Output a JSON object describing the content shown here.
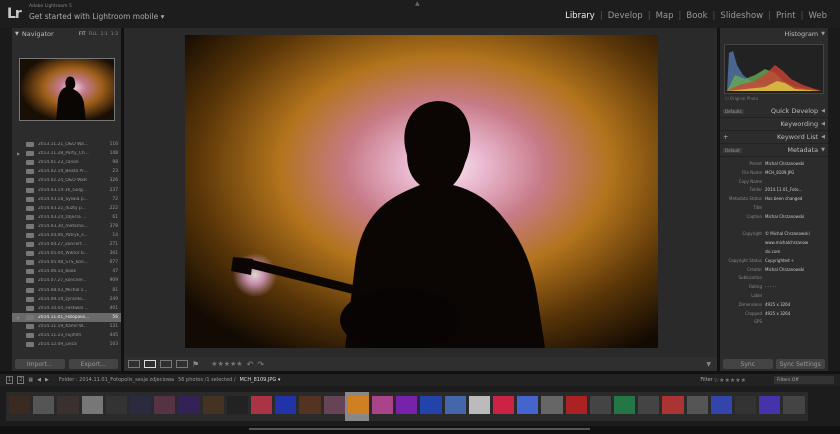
{
  "app": {
    "logo": "Lr",
    "name": "Adobe Lightroom 5",
    "identity_plate": "Get started with Lightroom mobile ▾"
  },
  "modules": [
    "Library",
    "Develop",
    "Map",
    "Book",
    "Slideshow",
    "Print",
    "Web"
  ],
  "active_module": "Library",
  "navigator": {
    "title": "Navigator",
    "zoom_options": [
      "FIT",
      "FILL",
      "1:1",
      "1:3"
    ]
  },
  "folders": [
    {
      "name": "2013.11.21_O&O Wa...",
      "count": "116"
    },
    {
      "name": "2013.11.28_Party_Ch...",
      "count": "148"
    },
    {
      "name": "2014.01.23_canon",
      "count": "98"
    },
    {
      "name": "2014.02.19_Beata Pr...",
      "count": "23"
    },
    {
      "name": "2014.02.24_O&O WaR",
      "count": "326"
    },
    {
      "name": "2014.03.14-16_Golg...",
      "count": "237"
    },
    {
      "name": "2014.03.18_Sylwia p...",
      "count": "72"
    },
    {
      "name": "2014.03.22_duzty p...",
      "count": "222"
    },
    {
      "name": "2014.03.24_zdjecia ...",
      "count": "61"
    },
    {
      "name": "2014.03.30_metamo...",
      "count": "378"
    },
    {
      "name": "2014.04.06_Patryk_s...",
      "count": "14"
    },
    {
      "name": "2014.04.27_koncert ...",
      "count": "271"
    },
    {
      "name": "2014.05.04_Wiktor b...",
      "count": "361"
    },
    {
      "name": "2014.05.08_STS_kon...",
      "count": "677"
    },
    {
      "name": "2014.06.14_book",
      "count": "47"
    },
    {
      "name": "2014.07.27_koncner...",
      "count": "909"
    },
    {
      "name": "2014.08.03_Michal s...",
      "count": "81"
    },
    {
      "name": "2014.09.19_zyrardo...",
      "count": "249"
    },
    {
      "name": "2014.10.04_Festiwal ...",
      "count": "401"
    },
    {
      "name": "2014.11.01_Fotopolis...",
      "count": "56",
      "selected": true
    },
    {
      "name": "2014.11.19_Kamil W...",
      "count": "131"
    },
    {
      "name": "2014.11.23_Fujifilm",
      "count": "445"
    },
    {
      "name": "2014.12.09_Leica",
      "count": "103"
    }
  ],
  "left_buttons": {
    "import": "Import...",
    "export": "Export..."
  },
  "right_panel": {
    "histogram": "Histogram",
    "original_photo": "Original Photo",
    "quick_develop": "Quick Develop",
    "quick_develop_preset": "Defaults",
    "keywording": "Keywording",
    "keyword_list": "Keyword List",
    "metadata": "Metadata",
    "metadata_preset": "Default"
  },
  "metadata": [
    {
      "key": "Preset",
      "value": "Michal Chrzanowski"
    },
    {
      "key": "File Name",
      "value": "MCH_8109.JPG"
    },
    {
      "key": "Copy Name",
      "value": ""
    },
    {
      "key": "Folder",
      "value": "2014.11.01_Foto..."
    },
    {
      "key": "Metadata Status",
      "value": "Has been changed"
    },
    {
      "key": "Title",
      "value": ""
    },
    {
      "key": "Caption",
      "value": "Michal Chrzanowski"
    },
    {
      "key": "",
      "value": ""
    },
    {
      "key": "Copyright",
      "value": "© Michal Chrzanowski"
    },
    {
      "key": "",
      "value": "www.michalchrzanow"
    },
    {
      "key": "",
      "value": "ski.com"
    },
    {
      "key": "Copyright Status",
      "value": "Copyrighted ÷"
    },
    {
      "key": "Creator",
      "value": "Michal Chrzanowski"
    },
    {
      "key": "Sublocation",
      "value": ""
    },
    {
      "key": "Rating",
      "value": "· · · · ·"
    },
    {
      "key": "Label",
      "value": ""
    },
    {
      "key": "Dimensions",
      "value": "4925 x 3264"
    },
    {
      "key": "Cropped",
      "value": "4925 x 3264"
    },
    {
      "key": "GPS",
      "value": ""
    }
  ],
  "right_buttons": {
    "sync": "Sync",
    "sync_settings": "Sync Settings"
  },
  "toolbar": {
    "rating": "★★★★★"
  },
  "filmstrip_bar": {
    "page1": "1",
    "page2": "2",
    "breadcrumb": "Folder : 2014.11.01_Fotopolis_sesja zdjeciowa",
    "count": "56 photos /1 selected /",
    "selected_file": "MCH_8109.JPG ▾",
    "filter_label": "Filter :",
    "filter_value": "Filters Off"
  },
  "colors": {
    "photo_glow": "#d89a1a",
    "photo_pink": "#c06890",
    "panel": "#2c2c2c"
  }
}
